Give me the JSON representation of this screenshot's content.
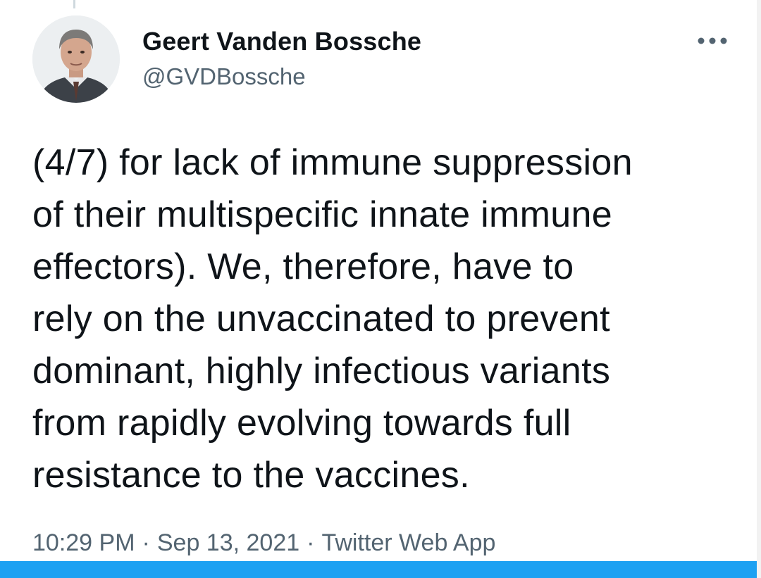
{
  "tweet": {
    "author": {
      "name": "Geert Vanden Bossche",
      "handle": "@GVDBossche",
      "avatar_icon": "profile-photo"
    },
    "more_icon": "more-horizontal-icon",
    "text": "(4/7) for lack of immune suppression\nof their multispecific innate immune\neffectors). We, therefore, have to\nrely on the unvaccinated to prevent\ndominant, highly infectious variants\nfrom rapidly evolving towards full\nresistance to the vaccines.",
    "time": "10:29 PM",
    "date": "Sep 13, 2021",
    "source": "Twitter Web App",
    "separator": "·"
  },
  "colors": {
    "text_primary": "#0f1419",
    "text_secondary": "#536471",
    "accent_bar": "#1da1f2"
  }
}
